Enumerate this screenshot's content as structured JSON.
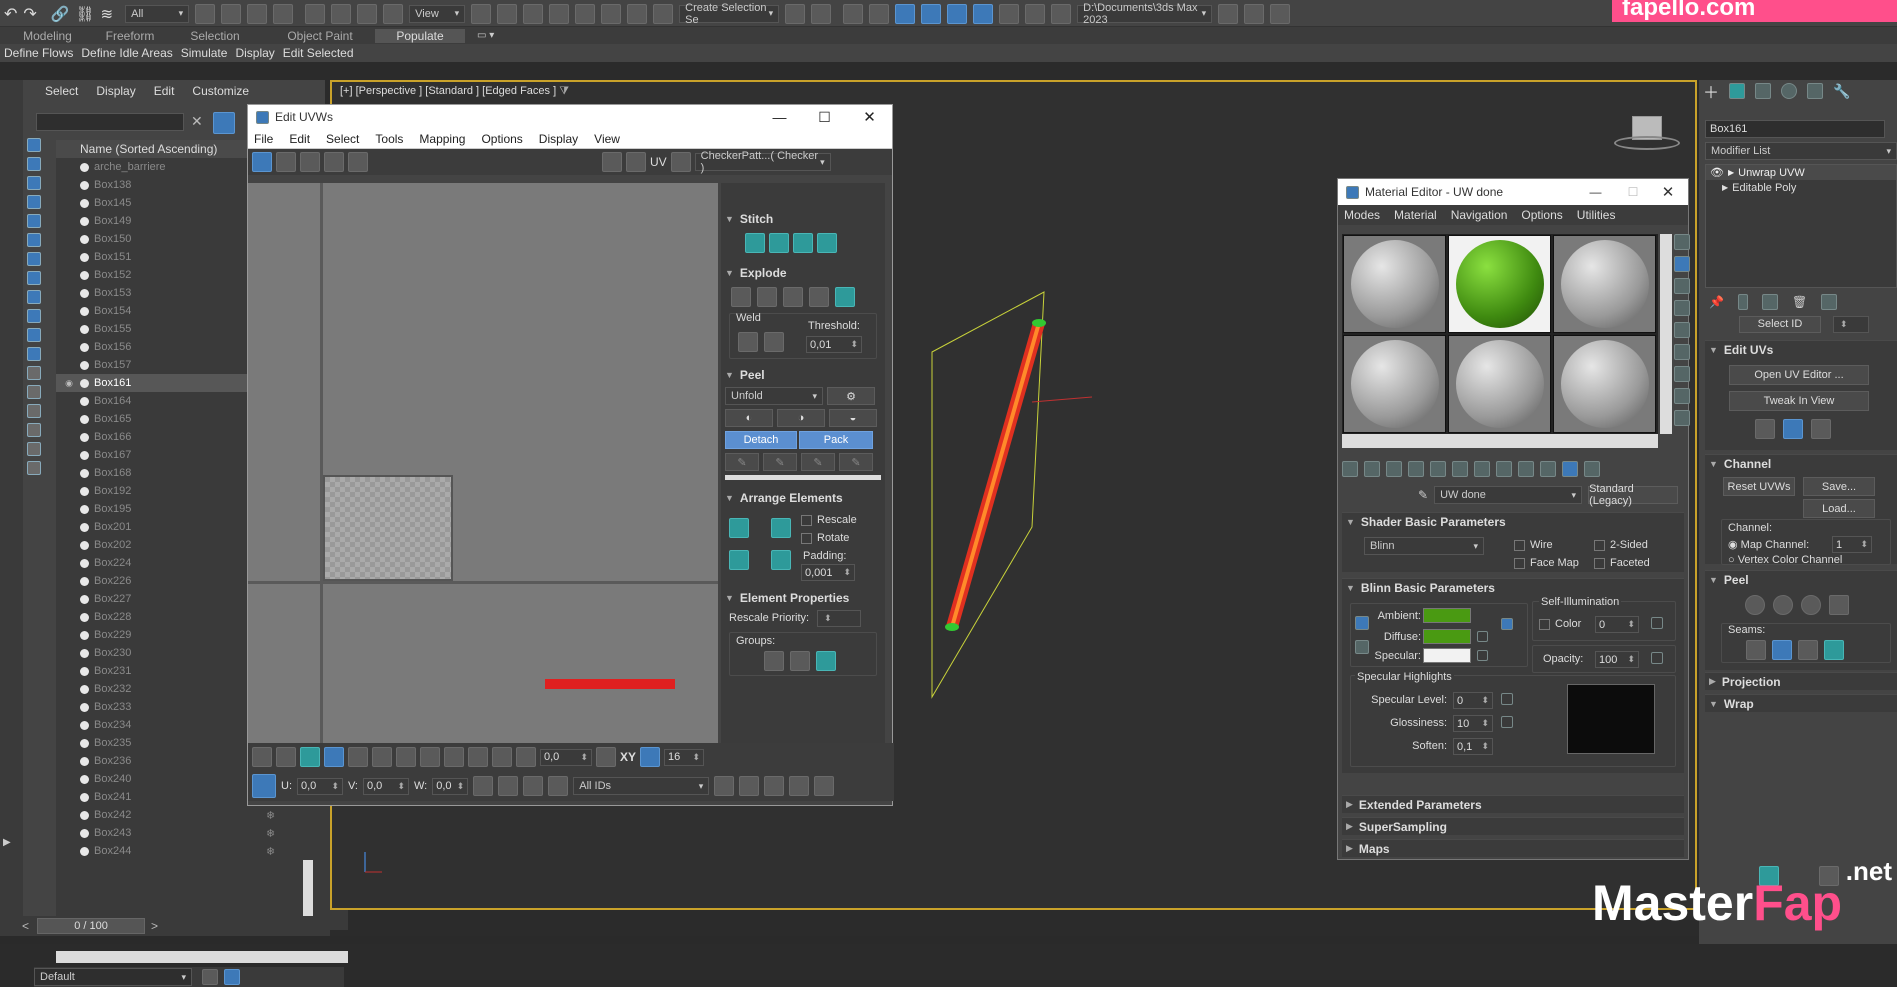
{
  "top_toolbar": {
    "filter_all": "All",
    "view": "View",
    "selection_set": "Create Selection Se",
    "path": "D:\\Documents\\3ds Max 2023",
    "watermark_top": "fapello.com"
  },
  "ribbon_tabs": [
    "Modeling",
    "Freeform",
    "Selection",
    "Object Paint",
    "Populate"
  ],
  "ribbon_active": "Populate",
  "populate_items": [
    "Define Flows",
    "Define Idle Areas",
    "Simulate",
    "Display",
    "Edit Selected"
  ],
  "scene_explorer": {
    "menus": [
      "Select",
      "Display",
      "Edit",
      "Customize"
    ],
    "column_header": "Name (Sorted Ascending)",
    "items": [
      "arche_barriere",
      "Box138",
      "Box145",
      "Box149",
      "Box150",
      "Box151",
      "Box152",
      "Box153",
      "Box154",
      "Box155",
      "Box156",
      "Box157",
      "Box161",
      "Box164",
      "Box165",
      "Box166",
      "Box167",
      "Box168",
      "Box192",
      "Box195",
      "Box201",
      "Box202",
      "Box224",
      "Box226",
      "Box227",
      "Box228",
      "Box229",
      "Box230",
      "Box231",
      "Box232",
      "Box233",
      "Box234",
      "Box235",
      "Box236",
      "Box240",
      "Box241",
      "Box242",
      "Box243",
      "Box244"
    ],
    "selected": "Box161",
    "layer": "Default",
    "timeline": "0 / 100"
  },
  "viewport": {
    "label": "[+] [Perspective ] [Standard ] [Edged Faces ]"
  },
  "uv_editor": {
    "title": "Edit UVWs",
    "menus": [
      "File",
      "Edit",
      "Select",
      "Tools",
      "Mapping",
      "Options",
      "Display",
      "View"
    ],
    "uv_label": "UV",
    "texture_dropdown": "CheckerPatt...( Checker )",
    "stitch": "Stitch",
    "explode": "Explode",
    "weld": "Weld",
    "threshold_label": "Threshold:",
    "threshold_value": "0,01",
    "peel": "Peel",
    "unfold": "Unfold",
    "detach": "Detach",
    "pack": "Pack",
    "arrange": "Arrange Elements",
    "rescale": "Rescale",
    "rotate": "Rotate",
    "padding_label": "Padding:",
    "padding_value": "0,001",
    "element_props": "Element Properties",
    "rescale_priority": "Rescale Priority:",
    "groups": "Groups:",
    "angle_value": "0,0",
    "xy": "XY",
    "pixel_value": "16",
    "u_label": "U:",
    "u_value": "0,0",
    "v_label": "V:",
    "v_value": "0,0",
    "w_label": "W:",
    "w_value": "0,0",
    "ids": "All IDs"
  },
  "material_editor": {
    "title": "Material Editor - UW done",
    "menus": [
      "Modes",
      "Material",
      "Navigation",
      "Options",
      "Utilities"
    ],
    "material_name": "UW done",
    "material_type": "Standard (Legacy)",
    "shader_section": "Shader Basic Parameters",
    "shader": "Blinn",
    "wire": "Wire",
    "two_sided": "2-Sided",
    "face_map": "Face Map",
    "faceted": "Faceted",
    "blinn_section": "Blinn Basic Parameters",
    "self_illum": "Self-Illumination",
    "color_label": "Color",
    "color_value": "0",
    "ambient": "Ambient:",
    "diffuse": "Diffuse:",
    "specular": "Specular:",
    "opacity_label": "Opacity:",
    "opacity_value": "100",
    "spec_highlights": "Specular Highlights",
    "spec_level": "Specular Level:",
    "spec_level_value": "0",
    "glossiness": "Glossiness:",
    "glossiness_value": "10",
    "soften": "Soften:",
    "soften_value": "0,1",
    "extended": "Extended Parameters",
    "supersampling": "SuperSampling",
    "maps": "Maps",
    "ambient_color": "#4a9a12",
    "diffuse_color": "#4a9a12",
    "specular_color": "#f2f2f2"
  },
  "command_panel": {
    "object_name": "Box161",
    "modifier_list": "Modifier List",
    "modifiers": [
      "Unwrap UVW",
      "Editable Poly"
    ],
    "select_id": "Select ID",
    "edit_uvs": "Edit UVs",
    "open_uv_editor": "Open UV Editor ...",
    "tweak_in_view": "Tweak In View",
    "channel": "Channel",
    "reset_uvws": "Reset UVWs",
    "save": "Save...",
    "load": "Load...",
    "channel_label": "Channel:",
    "map_channel": "Map Channel:",
    "map_channel_value": "1",
    "vertex_color_channel": "Vertex Color Channel",
    "peel": "Peel",
    "seams": "Seams:",
    "projection": "Projection",
    "wrap": "Wrap"
  },
  "watermark": {
    "brand1": "Master",
    "brand2": "Fap",
    "suffix": ".net"
  }
}
